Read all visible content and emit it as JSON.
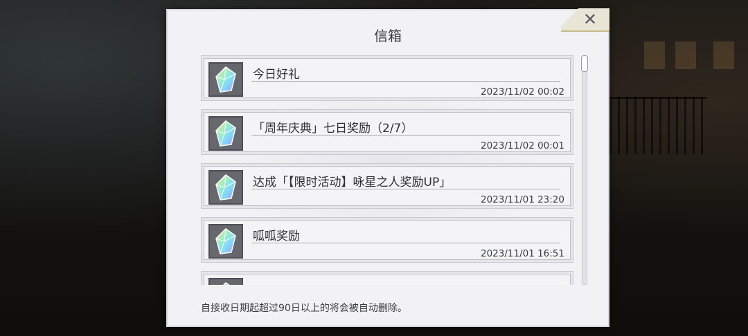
{
  "dialog": {
    "title": "信箱",
    "close_icon": "close-icon",
    "footer_note": "自接收日期起超过90日以上的将会被自动删除。"
  },
  "mails": [
    {
      "subject": "今日好礼",
      "date": "2023/11/02 00:02",
      "icon": "crystal-gem-icon"
    },
    {
      "subject": "「周年庆典」七日奖励（2/7）",
      "date": "2023/11/02 00:01",
      "icon": "crystal-gem-icon"
    },
    {
      "subject": "达成「【限时活动】咏星之人奖励UP」",
      "date": "2023/11/01 23:20",
      "icon": "crystal-gem-icon"
    },
    {
      "subject": "呱呱奖励",
      "date": "2023/11/01 16:51",
      "icon": "crystal-gem-icon"
    },
    {
      "subject": "",
      "date": "",
      "icon": "crystal-gem-icon"
    }
  ]
}
